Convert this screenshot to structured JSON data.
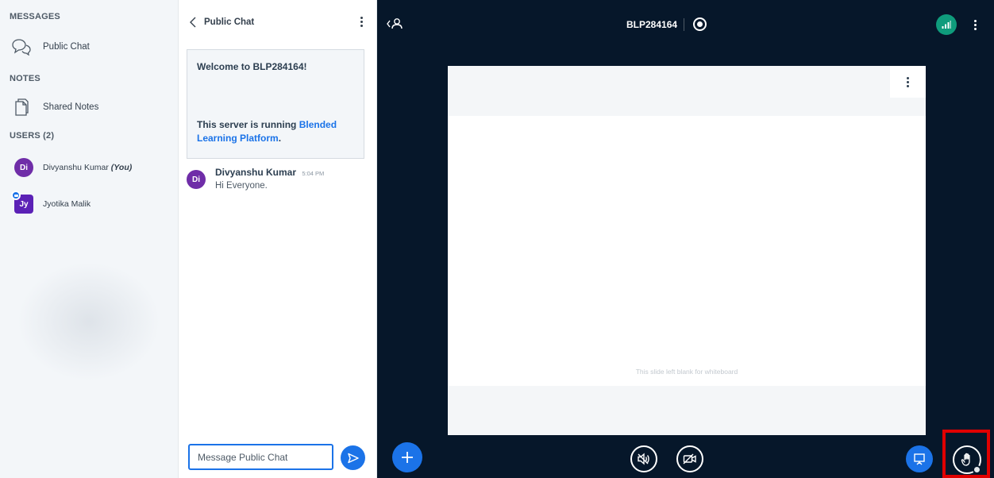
{
  "userlist": {
    "messages_title": "MESSAGES",
    "public_chat_label": "Public Chat",
    "notes_title": "NOTES",
    "shared_notes_label": "Shared Notes",
    "users_title": "USERS (2)",
    "users": [
      {
        "initials": "Di",
        "name": "Divyanshu Kumar",
        "suffix": "(You)",
        "color": "#6f2da8"
      },
      {
        "initials": "Jy",
        "name": "Jyotika Malik",
        "suffix": "",
        "color": "#5b21b6"
      }
    ]
  },
  "chat": {
    "title": "Public Chat",
    "welcome_heading": "Welcome to BLP284164!",
    "welcome_text": "This server is running ",
    "welcome_link": "Blended Learning Platform",
    "welcome_end": ".",
    "messages": [
      {
        "initials": "Di",
        "sender": "Divyanshu Kumar",
        "time": "5:04 PM",
        "text": "Hi Everyone."
      }
    ],
    "input_placeholder": "Message Public Chat"
  },
  "main": {
    "meeting_name": "BLP284164",
    "slide_caption": "This slide left blank for whiteboard"
  },
  "colors": {
    "primary": "#1b73e8",
    "main_bg": "#06172a",
    "connection": "#0f9c7c",
    "highlight": "#e00000"
  },
  "icons": {
    "public_chat": "chat-bubbles-icon",
    "shared_notes": "document-icon",
    "send": "send-icon",
    "plus": "plus-icon",
    "audio": "speaker-icon",
    "video": "video-off-icon",
    "presentation": "presentation-icon",
    "hand": "raise-hand-icon"
  }
}
